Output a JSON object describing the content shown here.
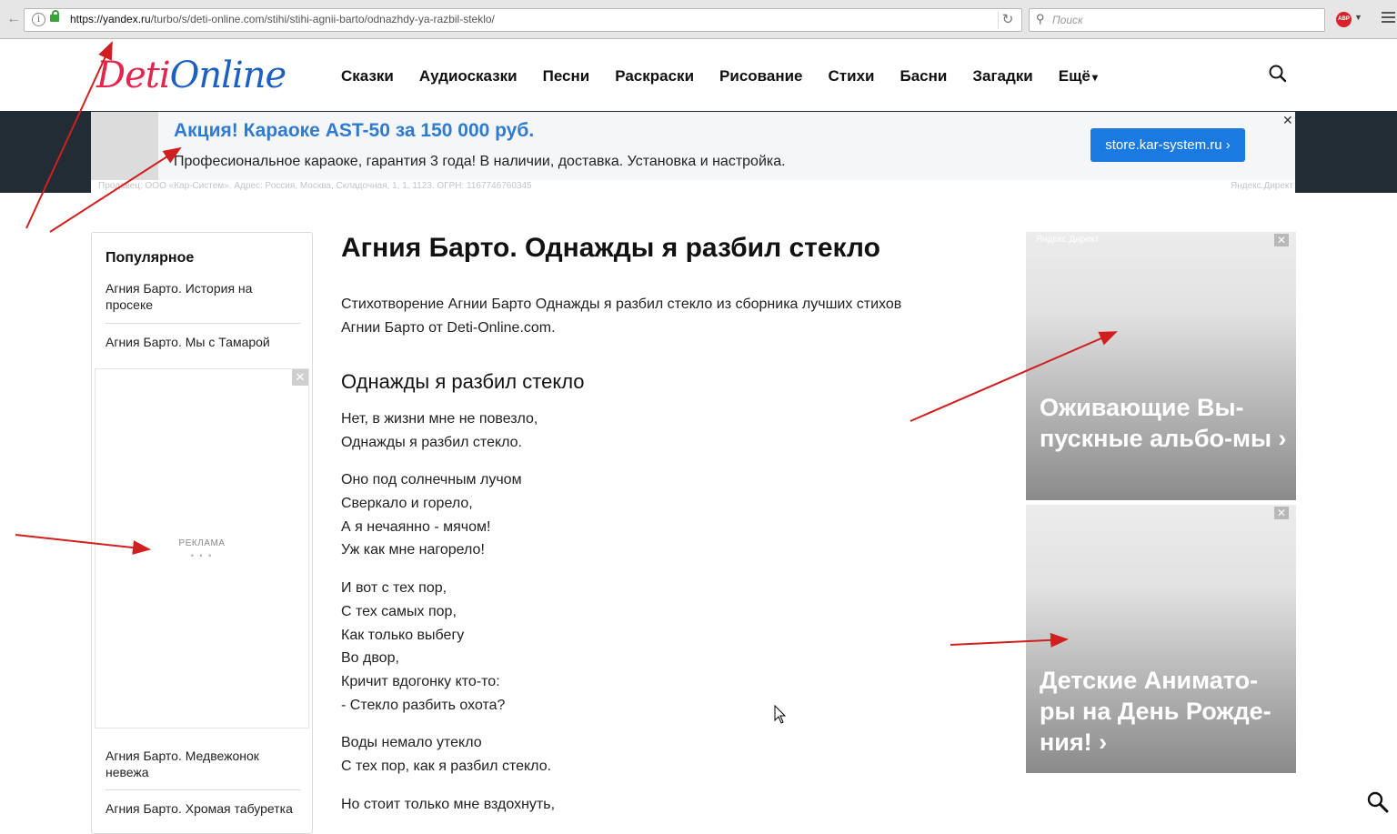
{
  "browser": {
    "url_host": "https://yandex.ru",
    "url_path": "/turbo/s/deti-online.com/stihi/stihi-agnii-barto/odnazhdy-ya-razbil-steklo/",
    "search_placeholder": "Поиск",
    "abp_label": "ABP"
  },
  "site": {
    "logo_part1": "Deti",
    "logo_part2": "Online",
    "nav": [
      "Сказки",
      "Аудиосказки",
      "Песни",
      "Раскраски",
      "Рисование",
      "Стихи",
      "Басни",
      "Загадки",
      "Ещё"
    ]
  },
  "top_ad": {
    "title": "Акция! Караоке AST-50 за 150 000 руб.",
    "description": "Професиональное караоке, гарантия 3 года! В наличии, доставка. Установка и настройка.",
    "button": "store.kar-system.ru ›",
    "close": "✕",
    "seller": "Продавец: ООО «Кар-Систем». Адрес: Россия, Москва, Складочная, 1, 1, 1123. ОГРН: 1167746760345",
    "source": "Яндекс.Директ"
  },
  "sidebar": {
    "title": "Популярное",
    "items": [
      "Агния Барто. История на просеке",
      "Агния Барто. Мы с Тамарой",
      "Агния Барто. Медвежонок невежа",
      "Агния Барто. Хромая табуретка"
    ],
    "ad_label": "РЕКЛАМА",
    "ad_dots": "• • •",
    "ad_close": "✕"
  },
  "article": {
    "title": "Агния Барто. Однажды я разбил стекло",
    "intro": "Стихотворение Агнии Барто Однажды я разбил стекло из сборника лучших стихов Агнии Барто от Deti-Online.com.",
    "poem_title": "Однажды я разбил стекло",
    "stanzas": [
      [
        "Нет, в жизни мне не повезло,",
        "Однажды я разбил стекло."
      ],
      [
        "Оно под солнечным лучом",
        "Сверкало и горело,",
        "А я нечаянно - мячом!",
        "Уж как мне нагорело!"
      ],
      [
        "И вот с тех пор,",
        "С тех самых пор,",
        "Как только выбегу",
        "Во двор,",
        "Кричит вдогонку кто-то:",
        "- Стекло разбить охота?"
      ],
      [
        "Воды немало утекло",
        "С тех пор, как я разбил стекло."
      ],
      [
        "Но стоит только мне вздохнуть,"
      ]
    ]
  },
  "right_ads": [
    {
      "source": "Яндекс.Директ",
      "text": "Оживающие Вы-пускные альбо-мы ›",
      "close": "✕"
    },
    {
      "source": "",
      "text": "Детские Анимато-ры на День Рожде-ния! ›",
      "close": "✕"
    }
  ],
  "colors": {
    "logo_red": "#e2264d",
    "logo_blue": "#1e5fc2",
    "ad_title_blue": "#2e7bd1",
    "ad_button_blue": "#1a7ae0",
    "annotation_red": "#d11f1f"
  }
}
